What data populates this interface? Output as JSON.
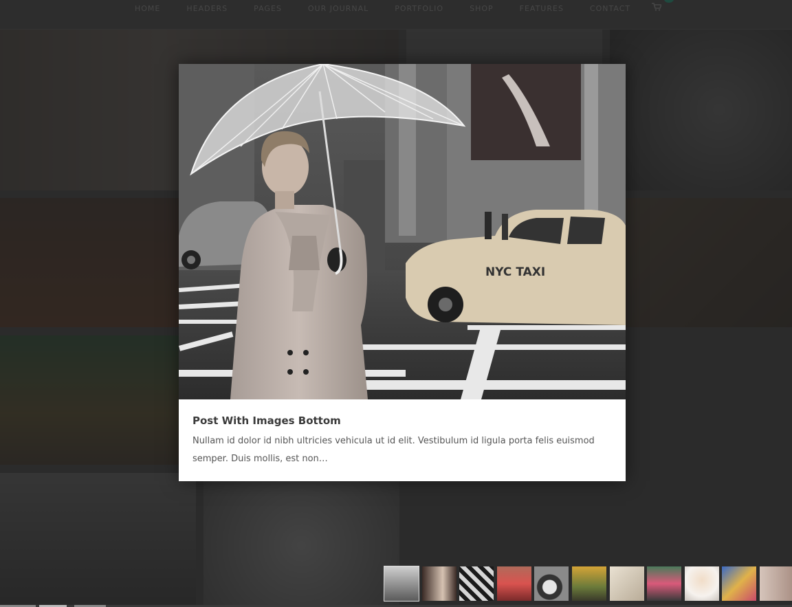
{
  "nav": {
    "items": [
      "HOME",
      "HEADERS",
      "PAGES",
      "OUR JOURNAL",
      "PORTFOLIO",
      "SHOP",
      "FEATURES",
      "CONTACT"
    ],
    "cart_icon": "shopping-cart-icon"
  },
  "lightbox": {
    "title": "Post With Images Bottom",
    "excerpt": "Nullam id dolor id nibh ultricies vehicula ut id elit. Vestibulum id ligula porta felis euismod semper. Duis mollis, est non…",
    "taxi_text": "NYC TAXI"
  },
  "thumbnails": {
    "count": 11,
    "active_index": 0
  },
  "colors": {
    "overlay": "#2b2b2b",
    "caption_bg": "#ffffff",
    "title": "#3a3a3a",
    "text": "#555555"
  }
}
